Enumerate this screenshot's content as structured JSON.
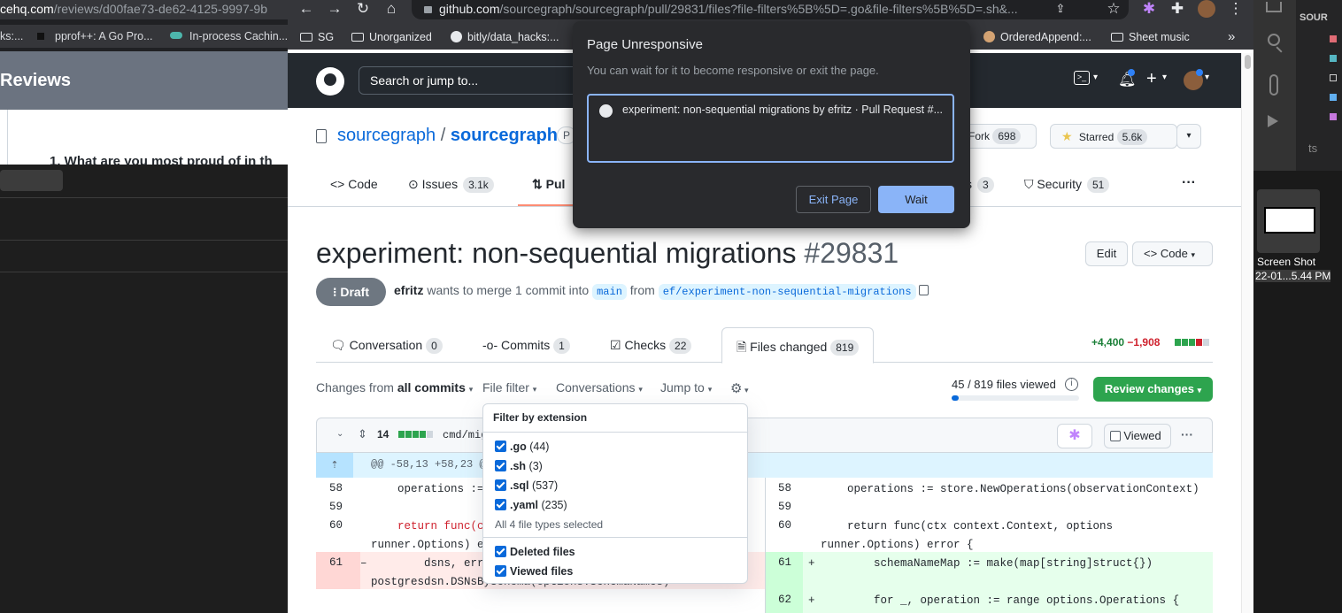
{
  "left_window": {
    "url_host": "cehq.com",
    "url_path": "/reviews/d00fae73-de62-4125-9997-9b",
    "bookmarks": [
      "ks:...",
      "pprof++: A Go Pro...",
      "In-process Cachin..."
    ],
    "header": "Reviews",
    "question": "1. What are you most proud of in th"
  },
  "vscode": {
    "title": "SOUR",
    "shot_label_1": "Screen Shot",
    "shot_label_2": "22-01...5.44 PM",
    "ts": "ts"
  },
  "browser": {
    "url_host": "github.com",
    "url_path": "/sourcegraph/sourcegraph/pull/29831/files?file-filters%5B%5D=.go&file-filters%5B%5D=.sh&...",
    "bookmarks": [
      "SG",
      "Unorganized",
      "bitly/data_hacks:...",
      "OrderedAppend:...",
      "Sheet music"
    ],
    "more_bookmarks": "»"
  },
  "github": {
    "search_placeholder": "Search or jump to...",
    "owner": "sourcegraph",
    "repo": "sourcegraph",
    "visibility_stub": "P",
    "fork_label": "Fork",
    "fork_count": "698",
    "star_label": "Starred",
    "star_count": "5.6k",
    "tabs": [
      {
        "label": "Code",
        "count": ""
      },
      {
        "label": "Issues",
        "count": "3.1k"
      },
      {
        "label": "Pul",
        "count": ""
      },
      {
        "label": "s",
        "count": "3"
      },
      {
        "label": "Security",
        "count": "51"
      }
    ],
    "more": "···"
  },
  "pr": {
    "title": "experiment: non-sequential migrations",
    "number": "#29831",
    "edit_label": "Edit",
    "code_label": "Code",
    "state": "Draft",
    "author": "efritz",
    "meta_text": "wants to merge 1 commit into",
    "base": "main",
    "from": "from",
    "head": "ef/experiment-non-sequential-migrations",
    "tabs": [
      {
        "label": "Conversation",
        "count": "0"
      },
      {
        "label": "Commits",
        "count": "1"
      },
      {
        "label": "Checks",
        "count": "22"
      },
      {
        "label": "Files changed",
        "count": "819"
      }
    ],
    "additions": "+4,400",
    "deletions": "−1,908",
    "changes_from_label": "Changes from",
    "changes_from_value": "all commits",
    "file_filter": "File filter",
    "conversations": "Conversations",
    "jump_to": "Jump to",
    "files_viewed": "45 / 819 files viewed",
    "files_viewed_fraction": 0.055,
    "review_changes": "Review changes"
  },
  "diff": {
    "file_changes": "14",
    "file_path": "cmd/mig",
    "viewed_label": "Viewed",
    "hunk": "@@ -58,13 +58,23 @",
    "left_lines": [
      {
        "n": "58",
        "code": "    operations := "
      },
      {
        "n": "59",
        "code": ""
      },
      {
        "n": "60",
        "code": "    return func(c"
      },
      {
        "n": "",
        "code": "runner.Options) e"
      },
      {
        "n": "61",
        "code": "        dsns, err"
      },
      {
        "n": "",
        "code": "postgresdsn.DSNsBySchema(options.SchemaNames)"
      }
    ],
    "right_lines": [
      {
        "n": "58",
        "code": "    operations := store.NewOperations(observationContext)"
      },
      {
        "n": "59",
        "code": ""
      },
      {
        "n": "60",
        "code": "    return func(ctx context.Context, options"
      },
      {
        "n": "",
        "code": "runner.Options) error {"
      },
      {
        "n": "61",
        "code": "        schemaNameMap := make(map[string]struct{})"
      },
      {
        "n": "",
        "code": ""
      },
      {
        "n": "62",
        "code": "        for _, operation := range options.Operations {"
      }
    ],
    "minus": "–",
    "plus": "+"
  },
  "filter_menu": {
    "header": "Filter by extension",
    "items": [
      {
        "ext": ".go",
        "count": "(44)"
      },
      {
        "ext": ".sh",
        "count": "(3)"
      },
      {
        "ext": ".sql",
        "count": "(537)"
      },
      {
        "ext": ".yaml",
        "count": "(235)"
      }
    ],
    "summary": "All 4 file types selected",
    "deleted": "Deleted files",
    "viewed": "Viewed files"
  },
  "dialog": {
    "title": "Page Unresponsive",
    "subtitle": "You can wait for it to become responsive or exit the page.",
    "page_title": "experiment: non-sequential migrations by efritz · Pull Request #...",
    "exit_label": "Exit Page",
    "wait_label": "Wait"
  },
  "colors": {
    "accent": "#0969da",
    "green": "#2da44e",
    "dialog": "#292a2d",
    "dialog_button": "#8ab4f8"
  }
}
